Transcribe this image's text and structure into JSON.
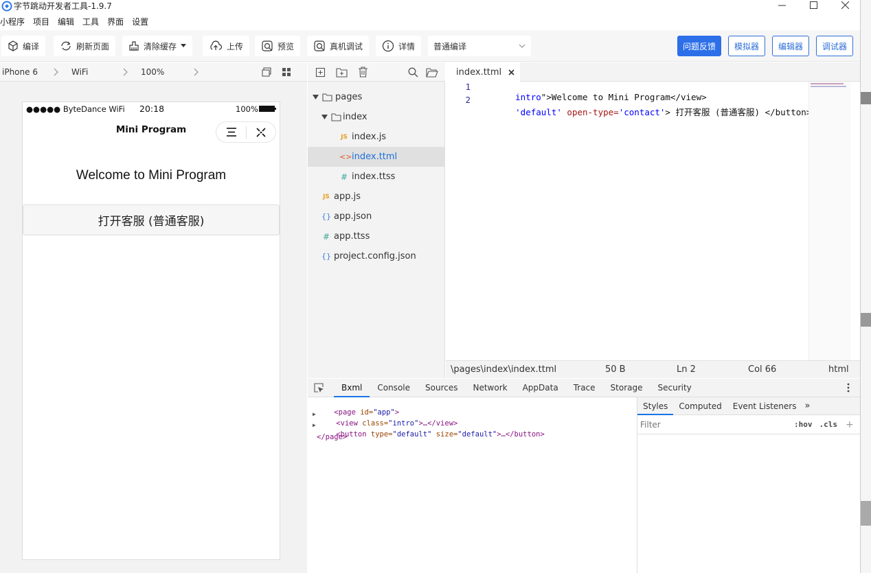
{
  "window": {
    "title": "字节跳动开发者工具-1.9.7",
    "controls": [
      "minimize",
      "maximize",
      "close"
    ]
  },
  "menubar": [
    "小程序",
    "项目",
    "编辑",
    "工具",
    "界面",
    "设置"
  ],
  "toolbar": {
    "compile": "编译",
    "refresh": "刷新页面",
    "clear_cache": "清除缓存",
    "upload": "上传",
    "preview": "预览",
    "real_debug": "真机调试",
    "details": "详情",
    "compile_mode": "普通编译",
    "feedback": "问题反馈",
    "simulator": "模拟器",
    "editor": "编辑器",
    "debugger": "调试器"
  },
  "simulator_bar": {
    "device": "iPhone 6",
    "network": "WiFi",
    "zoom": "100%"
  },
  "phone": {
    "carrier": "●●●●● ByteDance WiFi",
    "time": "20:18",
    "battery": "100%",
    "nav_title": "Mini Program",
    "welcome": "Welcome to Mini Program",
    "contact_button": "打开客服 (普通客服)"
  },
  "explorer": {
    "items": [
      {
        "label": "pages",
        "type": "folder",
        "level": 0
      },
      {
        "label": "index",
        "type": "folder",
        "level": 1
      },
      {
        "label": "index.js",
        "type": "js",
        "level": 2
      },
      {
        "label": "index.ttml",
        "type": "ttml",
        "level": 2,
        "selected": true
      },
      {
        "label": "index.ttss",
        "type": "ttss",
        "level": 2
      },
      {
        "label": "app.js",
        "type": "js",
        "level": 0
      },
      {
        "label": "app.json",
        "type": "json",
        "level": 0
      },
      {
        "label": "app.ttss",
        "type": "ttss",
        "level": 0
      },
      {
        "label": "project.config.json",
        "type": "json",
        "level": 0
      }
    ]
  },
  "editor": {
    "tab": "index.ttml",
    "lines": [
      {
        "num": "1",
        "a": "intro",
        "b": "\">Welcome to Mini Program</view>"
      },
      {
        "num": "2",
        "a": "'default'",
        "b": " open-type=",
        "c": "'contact'",
        "d": "> 打开客服 (普通客服) </button>"
      }
    ],
    "status": {
      "path": "\\pages\\index\\index.ttml",
      "size": "50 B",
      "ln": "Ln 2",
      "col": "Col 66",
      "lang": "html"
    }
  },
  "devtools": {
    "tabs": [
      "Bxml",
      "Console",
      "Sources",
      "Network",
      "AppData",
      "Trace",
      "Storage",
      "Security"
    ],
    "dom": {
      "l1_tag": "<page",
      "l1_attr": " id=",
      "l1_val": "\"app\"",
      "l1_end": ">",
      "l2_tag": "<view",
      "l2_attr": " class=",
      "l2_val": "\"intro\"",
      "l2_end": ">…</view>",
      "l3_tag": "<button",
      "l3_attr1": " type=",
      "l3_val1": "\"default\"",
      "l3_attr2": " size=",
      "l3_val2": "\"default\"",
      "l3_end": ">…</button>",
      "l4": "</page>"
    },
    "styles_tabs": [
      "Styles",
      "Computed",
      "Event Listeners"
    ],
    "filter_placeholder": "Filter",
    "hov": ":hov",
    "cls": ".cls"
  }
}
